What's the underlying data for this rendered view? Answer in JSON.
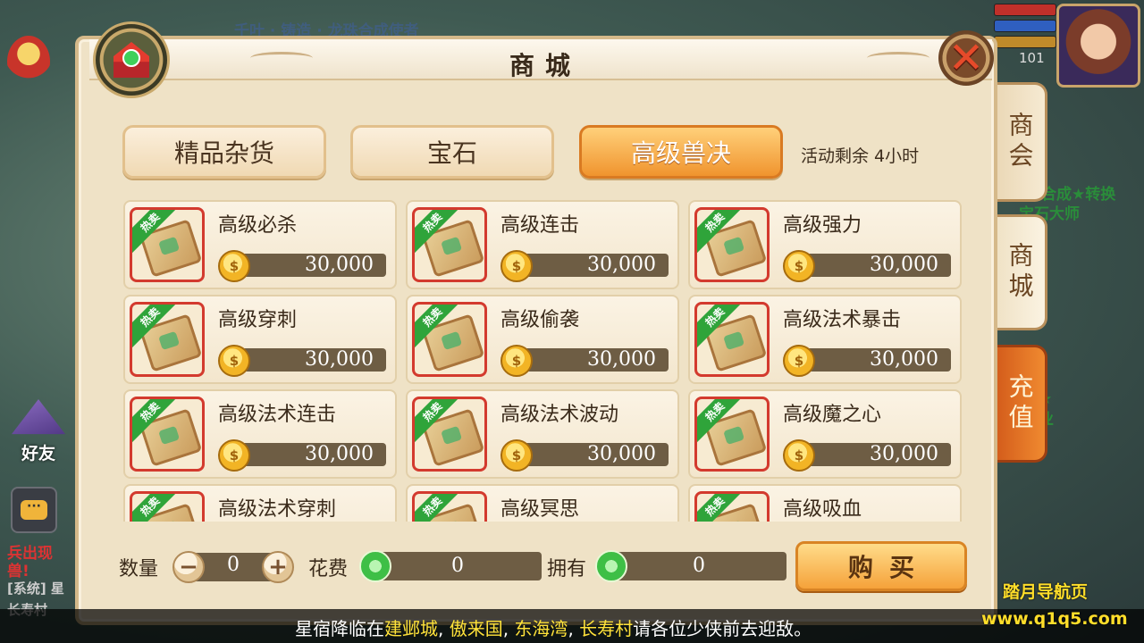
{
  "background": {
    "top_text": "千叶 · 铸造 · 龙珠合成使者",
    "right_text_1": "合成★转换",
    "right_text_2": "宝石大师",
    "right_text_3": "若★",
    "right_text_4": "中业",
    "chat_line_1": "兵出现",
    "chat_line_2": "兽!",
    "chat_line_3": "[系统] 星",
    "chat_line_4": "长寿村",
    "friends_label": "好友",
    "chat_icon_text": "···",
    "player_level": "101"
  },
  "panel": {
    "title": "商城",
    "close_symbol": "✕"
  },
  "side_tabs": [
    {
      "label": "商会"
    },
    {
      "label": "商城"
    },
    {
      "label": "充值"
    }
  ],
  "categories": [
    {
      "label": "精品杂货",
      "active": false
    },
    {
      "label": "宝石",
      "active": false
    },
    {
      "label": "高级兽决",
      "active": true
    }
  ],
  "event_timer": "活动剩余 4小时",
  "items": [
    {
      "name": "高级必杀",
      "price": "30,000",
      "badge": "热卖"
    },
    {
      "name": "高级连击",
      "price": "30,000",
      "badge": "热卖"
    },
    {
      "name": "高级强力",
      "price": "30,000",
      "badge": "热卖"
    },
    {
      "name": "高级穿刺",
      "price": "30,000",
      "badge": "热卖"
    },
    {
      "name": "高级偷袭",
      "price": "30,000",
      "badge": "热卖"
    },
    {
      "name": "高级法术暴击",
      "price": "30,000",
      "badge": "热卖"
    },
    {
      "name": "高级法术连击",
      "price": "30,000",
      "badge": "热卖"
    },
    {
      "name": "高级法术波动",
      "price": "30,000",
      "badge": "热卖"
    },
    {
      "name": "高级魔之心",
      "price": "30,000",
      "badge": "热卖"
    },
    {
      "name": "高级法术穿刺",
      "price": "",
      "badge": "热卖"
    },
    {
      "name": "高级冥思",
      "price": "",
      "badge": "热卖"
    },
    {
      "name": "高级吸血",
      "price": "",
      "badge": "热卖"
    }
  ],
  "coin_glyph": "$",
  "purchase": {
    "qty_label": "数量",
    "qty_value": "0",
    "minus_symbol": "−",
    "plus_symbol": "+",
    "cost_label": "花费",
    "cost_value": "0",
    "own_label": "拥有",
    "own_value": "0",
    "buy_label": "购买"
  },
  "notice": {
    "prefix": "星宿降临在",
    "places": [
      "建邺城",
      "傲来国",
      "东海湾",
      "长寿村"
    ],
    "separator": ", ",
    "suffix": "请各位少侠前去迎敌。"
  },
  "watermark": {
    "line1": "踏月导航页",
    "line2": "www.q1q5.com"
  },
  "colors": {
    "accent_orange": "#f0942e",
    "panel_bg": "#efe2c6",
    "price_bar": "#6e5d44",
    "hot_green": "#2fa43a",
    "notice_highlight": "#ffe23a"
  }
}
